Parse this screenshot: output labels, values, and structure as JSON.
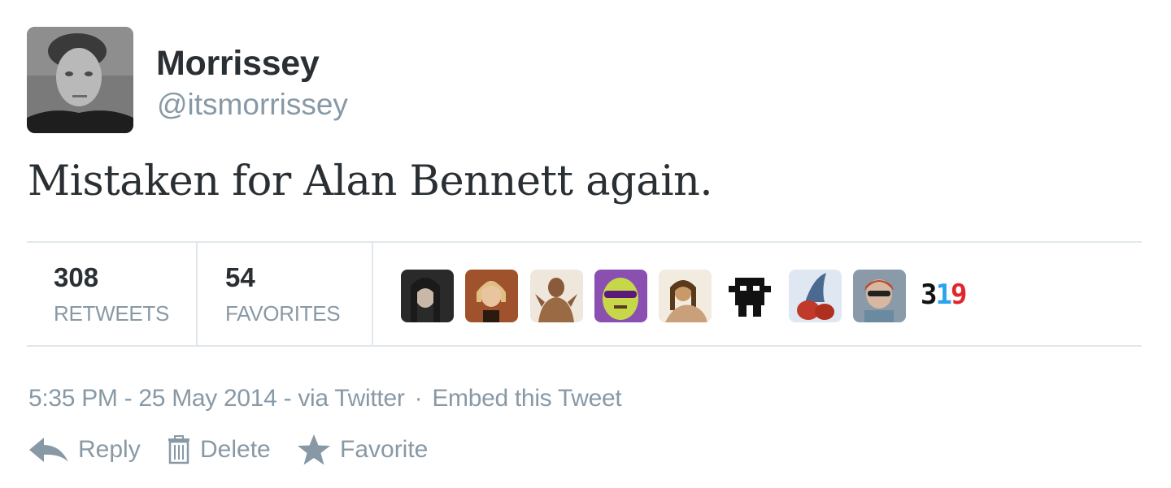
{
  "tweet": {
    "display_name": "Morrissey",
    "handle": "@itsmorrissey",
    "text": "Mistaken for Alan Bennett again.",
    "avatar_icon": "profile-photo"
  },
  "stats": {
    "retweets_count": "308",
    "retweets_label": "RETWEETS",
    "favorites_count": "54",
    "favorites_label": "FAVORITES",
    "more_count_parts": [
      "3",
      "1",
      "9"
    ],
    "favoriter_faces": [
      "face-1",
      "face-2",
      "face-3",
      "face-4",
      "face-5",
      "face-6",
      "face-7",
      "face-8"
    ]
  },
  "meta": {
    "time": "5:35 PM - 25 May 2014",
    "source": "via Twitter",
    "separator": "·",
    "embed_label": "Embed this Tweet"
  },
  "actions": {
    "reply_label": "Reply",
    "delete_label": "Delete",
    "favorite_label": "Favorite"
  },
  "colors": {
    "text": "#292f33",
    "muted": "#8899a6",
    "border": "#e1e8ed",
    "count_blue": "#2aa3ef",
    "count_red": "#e0262b"
  }
}
